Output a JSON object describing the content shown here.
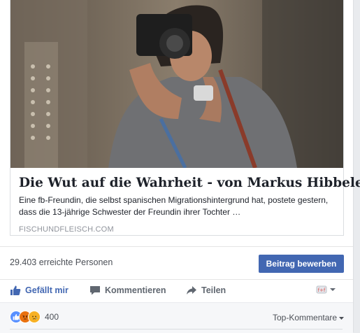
{
  "link_card": {
    "title": "Die Wut auf die Wahrheit - von Markus Hibbeler",
    "description": "Eine fb-Freundin, die selbst spanischen Migrationshintergrund hat, postete gestern, dass die 13-jährige Schwester der Freundin ihrer Tochter …",
    "domain": "FISCHUNDFLEISCH.COM"
  },
  "reach": {
    "count_text": "29.403 erreichte Personen",
    "boost_label": "Beitrag bewerben"
  },
  "actions": {
    "like_label": "Gefällt mir",
    "comment_label": "Kommentieren",
    "share_label": "Teilen"
  },
  "feedback": {
    "reaction_count": "400",
    "sort_label": "Top-Kommentare"
  },
  "colors": {
    "brand": "#4267b2",
    "like_reaction": "#5890ff",
    "angry_reaction": "#e9710f",
    "sad_reaction": "#f7b125"
  }
}
